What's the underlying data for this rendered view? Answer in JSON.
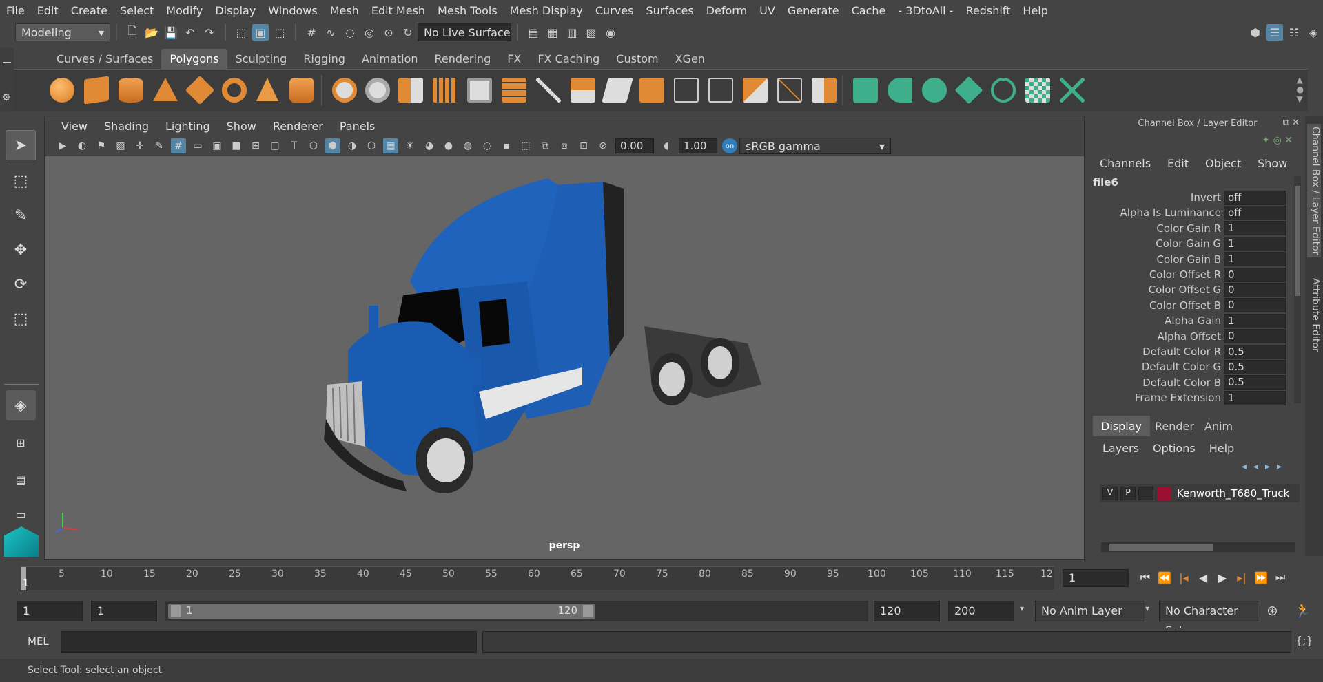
{
  "menubar": {
    "items": [
      "File",
      "Edit",
      "Create",
      "Select",
      "Modify",
      "Display",
      "Windows",
      "Mesh",
      "Edit Mesh",
      "Mesh Tools",
      "Mesh Display",
      "Curves",
      "Surfaces",
      "Deform",
      "UV",
      "Generate",
      "Cache",
      "- 3DtoAll -",
      "Redshift",
      "Help"
    ]
  },
  "statusline": {
    "workspace": "Modeling",
    "live_surface": "No Live Surface"
  },
  "shelf": {
    "tabs": [
      "Curves / Surfaces",
      "Polygons",
      "Sculpting",
      "Rigging",
      "Animation",
      "Rendering",
      "FX",
      "FX Caching",
      "Custom",
      "XGen"
    ],
    "active_tab": "Polygons"
  },
  "viewport": {
    "menu": [
      "View",
      "Shading",
      "Lighting",
      "Show",
      "Renderer",
      "Panels"
    ],
    "exposure": "0.00",
    "gamma": "1.00",
    "colorspace": "sRGB gamma",
    "camera_label": "persp"
  },
  "channelbox": {
    "title": "Channel Box / Layer Editor",
    "menu": [
      "Channels",
      "Edit",
      "Object",
      "Show"
    ],
    "node": "file6",
    "attributes": [
      {
        "name": "Invert",
        "value": "off"
      },
      {
        "name": "Alpha Is Luminance",
        "value": "off"
      },
      {
        "name": "Color Gain R",
        "value": "1"
      },
      {
        "name": "Color Gain G",
        "value": "1"
      },
      {
        "name": "Color Gain B",
        "value": "1"
      },
      {
        "name": "Color Offset R",
        "value": "0"
      },
      {
        "name": "Color Offset G",
        "value": "0"
      },
      {
        "name": "Color Offset B",
        "value": "0"
      },
      {
        "name": "Alpha Gain",
        "value": "1"
      },
      {
        "name": "Alpha Offset",
        "value": "0"
      },
      {
        "name": "Default Color R",
        "value": "0.5"
      },
      {
        "name": "Default Color G",
        "value": "0.5"
      },
      {
        "name": "Default Color B",
        "value": "0.5"
      },
      {
        "name": "Frame Extension",
        "value": "1"
      }
    ]
  },
  "side_tabs": {
    "channel_box": "Channel Box / Layer Editor",
    "attribute_editor": "Attribute Editor"
  },
  "layers": {
    "tabs": [
      "Display",
      "Render",
      "Anim"
    ],
    "active_tab": "Display",
    "menu": [
      "Layers",
      "Options",
      "Help"
    ],
    "rows": [
      {
        "v": "V",
        "p": "P",
        "name": "Kenworth_T680_Truck",
        "color": "#9b1030"
      }
    ]
  },
  "timeline": {
    "ticks": [
      "5",
      "10",
      "15",
      "20",
      "25",
      "30",
      "35",
      "40",
      "45",
      "50",
      "55",
      "60",
      "65",
      "70",
      "75",
      "80",
      "85",
      "90",
      "95",
      "100",
      "105",
      "110",
      "115",
      "12"
    ],
    "start_marker": "1",
    "current_frame": "1"
  },
  "range": {
    "start": "1",
    "playback_start": "1",
    "slider_start": "1",
    "slider_end": "120",
    "playback_end": "120",
    "end": "200",
    "anim_layer": "No Anim Layer",
    "character_set": "No Character Set"
  },
  "command": {
    "label": "MEL"
  },
  "status": {
    "help_text": "Select Tool: select an object"
  }
}
